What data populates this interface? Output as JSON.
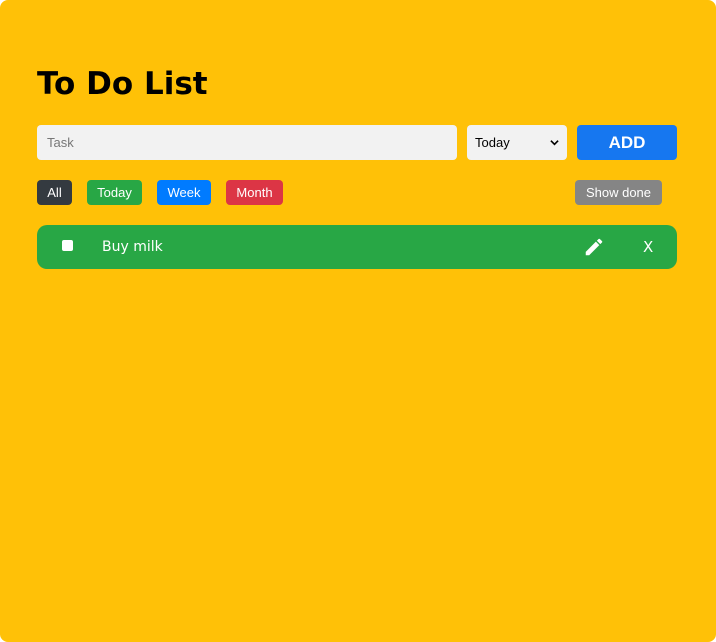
{
  "app": {
    "title": "To Do List",
    "background_color": "#ffc107"
  },
  "form": {
    "task_placeholder": "Task",
    "task_value": "",
    "when_selected": "Today",
    "add_label": "ADD",
    "add_color": "#1677f0"
  },
  "filters": [
    {
      "label": "All",
      "color": "#343a40"
    },
    {
      "label": "Today",
      "color": "#28a745"
    },
    {
      "label": "Week",
      "color": "#007bff"
    },
    {
      "label": "Month",
      "color": "#dc3545"
    }
  ],
  "show_done": {
    "label": "Show done",
    "color": "#858585"
  },
  "todos": [
    {
      "text": "Buy milk",
      "done": false,
      "color": "#28a745",
      "edit_icon": "pencil-icon",
      "delete_label": "X"
    }
  ]
}
